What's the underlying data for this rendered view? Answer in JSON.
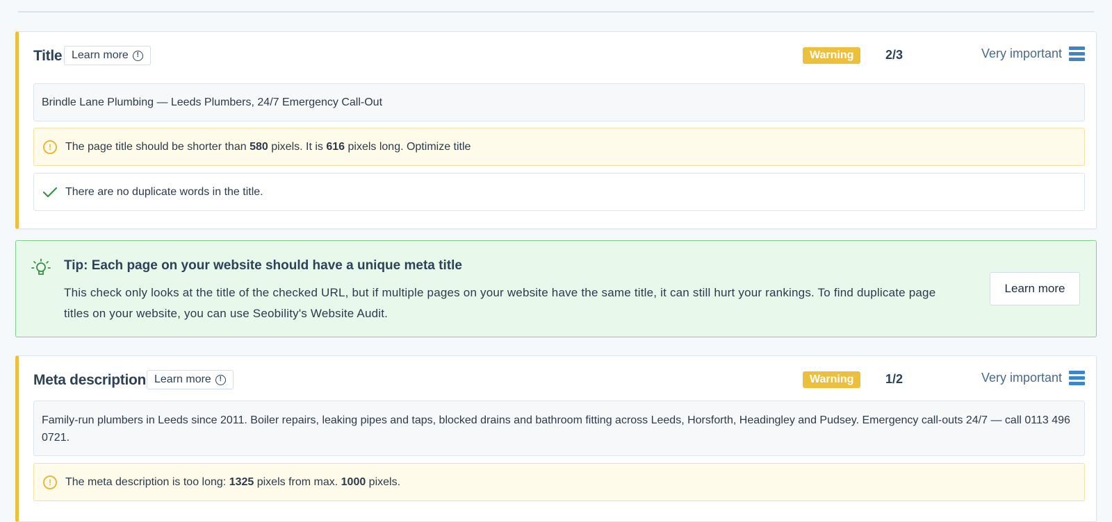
{
  "title_section": {
    "heading": "Title",
    "learn_more": "Learn more",
    "status": "Warning",
    "score": "2/3",
    "importance": "Very important",
    "value": "Brindle Lane Plumbing — Leeds Plumbers, 24/7 Emergency Call-Out",
    "warning": {
      "pre": "The page title should be shorter than ",
      "num1": "580",
      "mid": " pixels. It is ",
      "num2": "616",
      "post": " pixels long. Optimize title"
    },
    "ok_message": "There are no duplicate words in the title."
  },
  "tip": {
    "title": "Tip: Each page on your website should have a unique meta title",
    "text": "This check only looks at the title of the checked URL, but if multiple pages on your website have the same title, it can still hurt your rankings. To find duplicate page titles on your website, you can use Seobility's Website Audit.",
    "button": "Learn more"
  },
  "meta_section": {
    "heading": "Meta description",
    "learn_more": "Learn more",
    "status": "Warning",
    "score": "1/2",
    "importance": "Very important",
    "value": "Family-run plumbers in Leeds since 2011. Boiler repairs, leaking pipes and taps, blocked drains and bathroom fitting across Leeds, Horsforth, Headingley and Pudsey. Emergency call-outs 24/7 — call 0113 496 0721.",
    "warning": {
      "pre": "The meta description is too long: ",
      "num1": "1325",
      "mid": " pixels from max. ",
      "num2": "1000",
      "post": " pixels."
    }
  },
  "colors": {
    "warning": "#ecbf3c",
    "accent_blue": "#3e85c8",
    "tip_bg": "#e8f8ea",
    "tip_border": "#7fd08a",
    "ok_green": "#3a8f4a"
  },
  "icons": {
    "info": "info-circle-icon",
    "warning": "warning-circle-icon",
    "check": "check-icon",
    "bulb": "lightbulb-icon",
    "importance": "importance-bars-icon"
  }
}
